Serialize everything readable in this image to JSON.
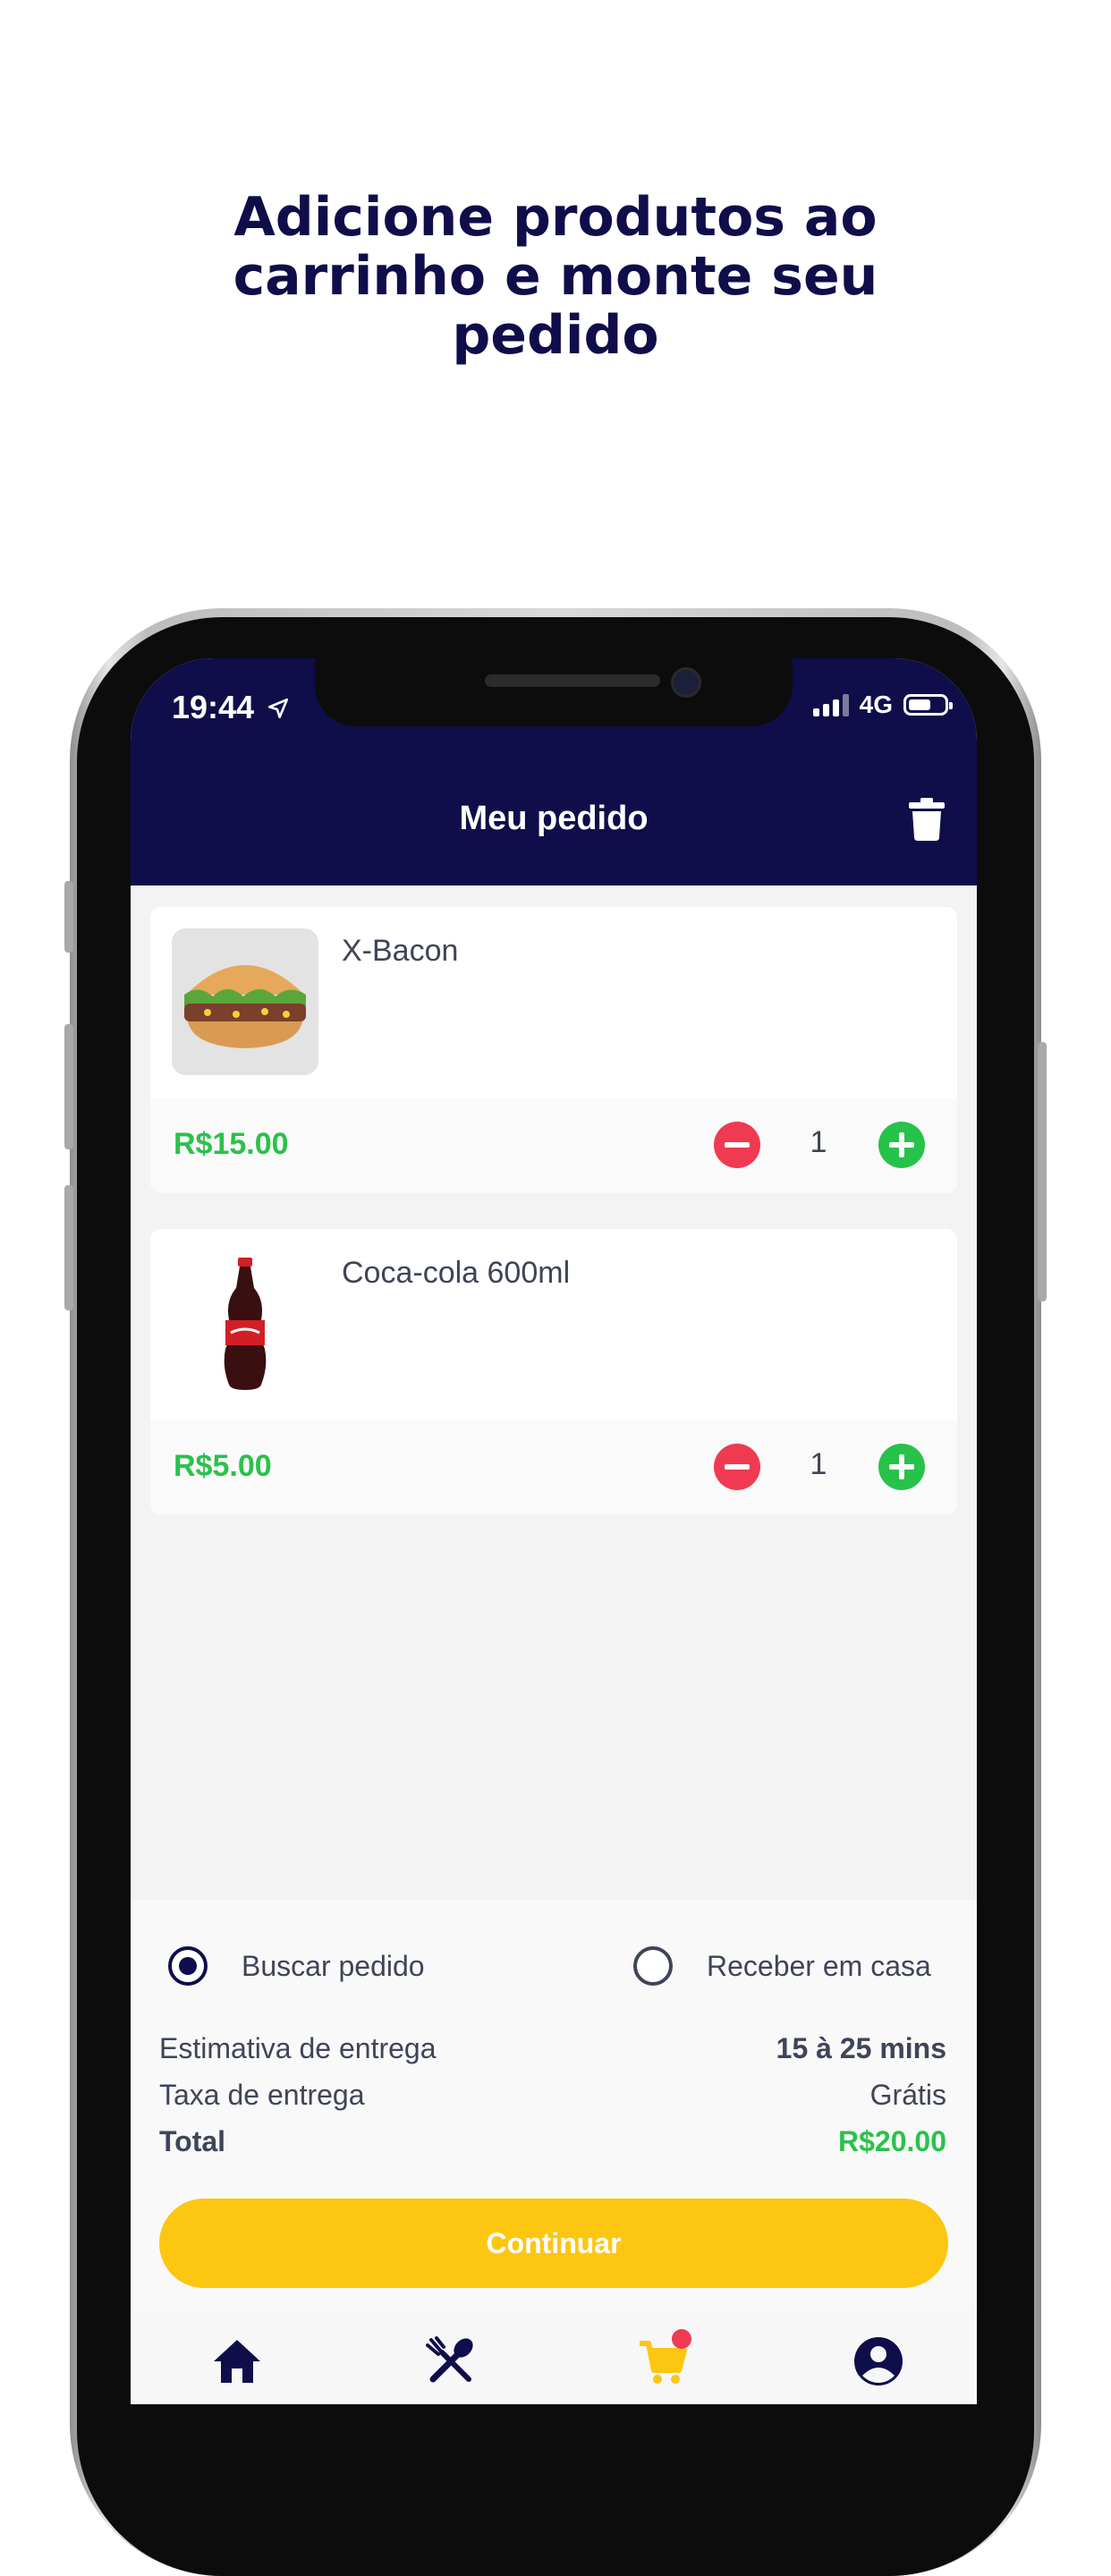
{
  "headline": {
    "line1": "Adicione produtos ao",
    "line2": "carrinho e monte seu",
    "line3": "pedido"
  },
  "status_bar": {
    "time": "19:44",
    "network": "4G",
    "battery_level": 0.62
  },
  "app_header": {
    "title": "Meu pedido"
  },
  "cart": {
    "items": [
      {
        "name": "X-Bacon",
        "price": "R$15.00",
        "quantity": "1"
      },
      {
        "name": "Coca-cola 600ml",
        "price": "R$5.00",
        "quantity": "1"
      }
    ]
  },
  "delivery_options": {
    "pickup": {
      "label": "Buscar pedido",
      "selected": true
    },
    "delivery": {
      "label": "Receber em casa",
      "selected": false
    }
  },
  "summary": {
    "estimate_label": "Estimativa de entrega",
    "estimate_value": "15 à 25 mins",
    "fee_label": "Taxa de entrega",
    "fee_value": "Grátis",
    "total_label": "Total",
    "total_value": "R$20.00"
  },
  "actions": {
    "continue_label": "Continuar"
  },
  "tab_bar": {
    "active": "cart",
    "cart_badge": true
  },
  "colors": {
    "navy": "#0f0e4a",
    "green": "#2bc14b",
    "red": "#ef3a52",
    "yellow": "#fdc611"
  }
}
